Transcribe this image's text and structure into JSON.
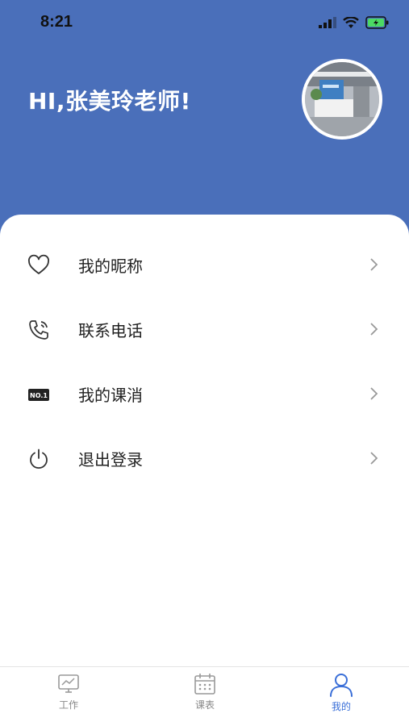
{
  "status_bar": {
    "time": "8:21"
  },
  "header": {
    "greeting": "HI,张美玲老师!"
  },
  "menu": {
    "items": [
      {
        "label": "我的昵称",
        "icon": "heart-icon"
      },
      {
        "label": "联系电话",
        "icon": "phone-icon"
      },
      {
        "label": "我的课消",
        "icon": "no1-badge-icon",
        "badge_text": "NO.1"
      },
      {
        "label": "退出登录",
        "icon": "power-icon"
      }
    ]
  },
  "tabbar": {
    "tabs": [
      {
        "label": "工作",
        "icon": "monitor-chart-icon"
      },
      {
        "label": "课表",
        "icon": "calendar-icon"
      },
      {
        "label": "我的",
        "icon": "user-icon",
        "active": true
      }
    ]
  },
  "colors": {
    "header_bg": "#4a6fba",
    "active_tab": "#3a6fd8"
  }
}
